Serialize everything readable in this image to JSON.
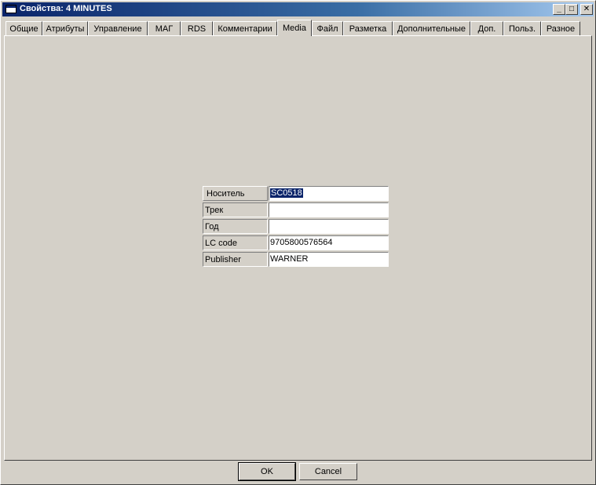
{
  "window": {
    "title": "Свойства: 4 MINUTES"
  },
  "tabs": [
    {
      "label": "Общие"
    },
    {
      "label": "Атрибуты"
    },
    {
      "label": "Управление"
    },
    {
      "label": "МАГ"
    },
    {
      "label": "RDS"
    },
    {
      "label": "Комментарии"
    },
    {
      "label": "Media",
      "active": true
    },
    {
      "label": "Файл"
    },
    {
      "label": "Разметка"
    },
    {
      "label": "Дополнительные"
    },
    {
      "label": "Доп."
    },
    {
      "label": "Польз."
    },
    {
      "label": "Разное"
    }
  ],
  "fields": [
    {
      "label": "Носитель",
      "value": "SC0518"
    },
    {
      "label": "Трек",
      "value": ""
    },
    {
      "label": "Год",
      "value": ""
    },
    {
      "label": "LC code",
      "value": "9705800576564"
    },
    {
      "label": "Publisher",
      "value": "WARNER"
    }
  ],
  "buttons": {
    "ok": "OK",
    "cancel": "Cancel"
  }
}
